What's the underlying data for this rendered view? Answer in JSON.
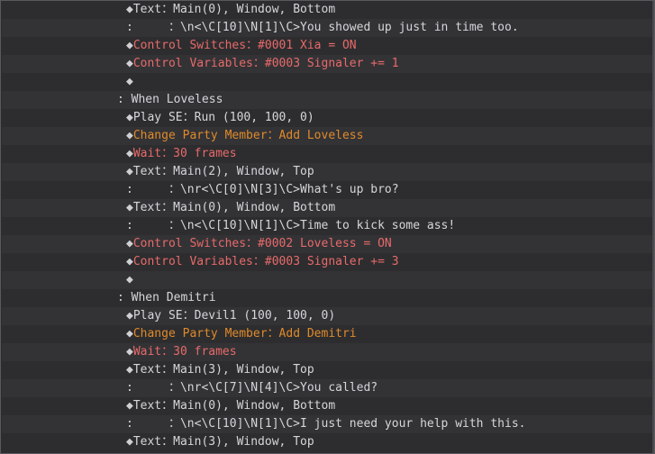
{
  "lines": [
    {
      "indent": 138,
      "type": "cmd",
      "color": "white",
      "diamond": "◆",
      "text": "Text：Main(0), Window, Bottom"
    },
    {
      "indent": 138,
      "type": "cont",
      "color": "white",
      "text": ":     ：\\n<\\C[10]\\N[1]\\C>You showed up just in time too."
    },
    {
      "indent": 138,
      "type": "cmd",
      "color": "red",
      "diamond": "◆",
      "text": "Control Switches：#0001 Xia = ON"
    },
    {
      "indent": 138,
      "type": "cmd",
      "color": "red",
      "diamond": "◆",
      "text": "Control Variables：#0003 Signaler += 1"
    },
    {
      "indent": 138,
      "type": "cmd",
      "color": "white",
      "diamond": "◆",
      "text": ""
    },
    {
      "indent": 128,
      "type": "branch",
      "color": "white",
      "text": ": When Loveless"
    },
    {
      "indent": 138,
      "type": "cmd",
      "color": "white",
      "diamond": "◆",
      "text": "Play SE：Run (100, 100, 0)"
    },
    {
      "indent": 138,
      "type": "cmd",
      "color": "orange",
      "diamond": "◆",
      "text": "Change Party Member：Add Loveless"
    },
    {
      "indent": 138,
      "type": "cmd",
      "color": "red",
      "diamond": "◆",
      "text": "Wait：30 frames"
    },
    {
      "indent": 138,
      "type": "cmd",
      "color": "white",
      "diamond": "◆",
      "text": "Text：Main(2), Window, Top"
    },
    {
      "indent": 138,
      "type": "cont",
      "color": "white",
      "text": ":     ：\\nr<\\C[0]\\N[3]\\C>What's up bro?"
    },
    {
      "indent": 138,
      "type": "cmd",
      "color": "white",
      "diamond": "◆",
      "text": "Text：Main(0), Window, Bottom"
    },
    {
      "indent": 138,
      "type": "cont",
      "color": "white",
      "text": ":     ：\\n<\\C[10]\\N[1]\\C>Time to kick some ass!"
    },
    {
      "indent": 138,
      "type": "cmd",
      "color": "red",
      "diamond": "◆",
      "text": "Control Switches：#0002 Loveless = ON"
    },
    {
      "indent": 138,
      "type": "cmd",
      "color": "red",
      "diamond": "◆",
      "text": "Control Variables：#0003 Signaler += 3"
    },
    {
      "indent": 138,
      "type": "cmd",
      "color": "white",
      "diamond": "◆",
      "text": ""
    },
    {
      "indent": 128,
      "type": "branch",
      "color": "white",
      "text": ": When Demitri"
    },
    {
      "indent": 138,
      "type": "cmd",
      "color": "white",
      "diamond": "◆",
      "text": "Play SE：Devil1 (100, 100, 0)"
    },
    {
      "indent": 138,
      "type": "cmd",
      "color": "orange",
      "diamond": "◆",
      "text": "Change Party Member：Add Demitri"
    },
    {
      "indent": 138,
      "type": "cmd",
      "color": "red",
      "diamond": "◆",
      "text": "Wait：30 frames"
    },
    {
      "indent": 138,
      "type": "cmd",
      "color": "white",
      "diamond": "◆",
      "text": "Text：Main(3), Window, Top"
    },
    {
      "indent": 138,
      "type": "cont",
      "color": "white",
      "text": ":     ：\\nr<\\C[7]\\N[4]\\C>You called?"
    },
    {
      "indent": 138,
      "type": "cmd",
      "color": "white",
      "diamond": "◆",
      "text": "Text：Main(0), Window, Bottom"
    },
    {
      "indent": 138,
      "type": "cont",
      "color": "white",
      "text": ":     ：\\n<\\C[10]\\N[1]\\C>I just need your help with this."
    },
    {
      "indent": 138,
      "type": "cmd",
      "color": "white",
      "diamond": "◆",
      "text": "Text：Main(3), Window, Top"
    }
  ]
}
